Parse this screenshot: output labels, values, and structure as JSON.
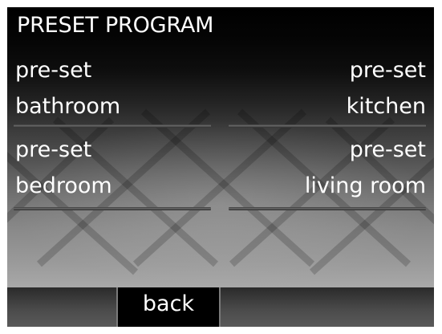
{
  "screen": {
    "title": "PRESET PROGRAM",
    "presets": [
      {
        "line1": "pre-set",
        "line2": "bathroom"
      },
      {
        "line1": "pre-set",
        "line2": "kitchen"
      },
      {
        "line1": "pre-set",
        "line2": "bedroom"
      },
      {
        "line1": "pre-set",
        "line2": "living room"
      }
    ],
    "back_label": "back"
  },
  "colors": {
    "text": "#ffffff",
    "background_top": "#000000",
    "background_bottom": "#b2b2b2",
    "back_button": "#000000"
  }
}
